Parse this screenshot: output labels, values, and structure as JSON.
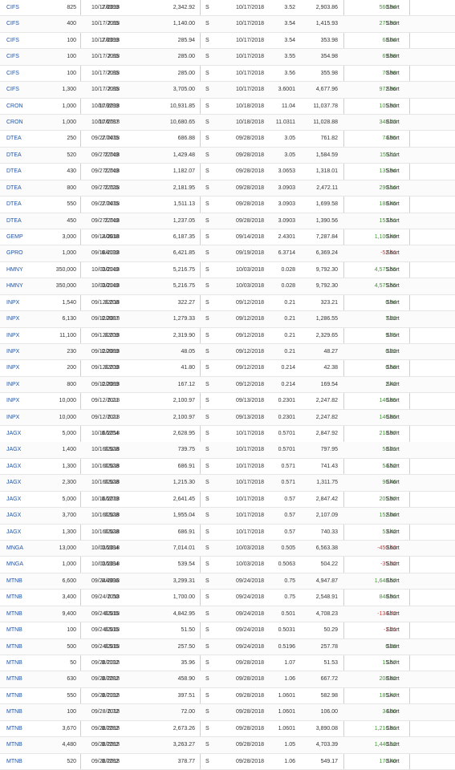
{
  "rows": [
    {
      "symbol": "CIFS",
      "qty": "825",
      "buy_date": "10/17/2018",
      "buy_price": "2.8399",
      "buy_amount": "2,342.92",
      "side": "S",
      "sell_date": "10/17/2018",
      "sell_price": "3.52",
      "sell_amount": "2,903.86",
      "pnl": "560.94",
      "pnl_sign": "pos",
      "term": "Short"
    },
    {
      "symbol": "CIFS",
      "qty": "400",
      "buy_date": "10/17/2018",
      "buy_price": "2.85",
      "buy_amount": "1,140.00",
      "side": "S",
      "sell_date": "10/17/2018",
      "sell_price": "3.54",
      "sell_amount": "1,415.93",
      "pnl": "275.93",
      "pnl_sign": "pos",
      "term": "Short"
    },
    {
      "symbol": "CIFS",
      "qty": "100",
      "buy_date": "10/17/2018",
      "buy_price": "2.8399",
      "buy_amount": "285.94",
      "side": "S",
      "sell_date": "10/17/2018",
      "sell_price": "3.54",
      "sell_amount": "353.98",
      "pnl": "68.04",
      "pnl_sign": "pos",
      "term": "Short"
    },
    {
      "symbol": "CIFS",
      "qty": "100",
      "buy_date": "10/17/2018",
      "buy_price": "2.85",
      "buy_amount": "285.00",
      "side": "S",
      "sell_date": "10/17/2018",
      "sell_price": "3.55",
      "sell_amount": "354.98",
      "pnl": "69.98",
      "pnl_sign": "pos",
      "term": "Short"
    },
    {
      "symbol": "CIFS",
      "qty": "100",
      "buy_date": "10/17/2018",
      "buy_price": "2.85",
      "buy_amount": "285.00",
      "side": "S",
      "sell_date": "10/17/2018",
      "sell_price": "3.56",
      "sell_amount": "355.98",
      "pnl": "70.98",
      "pnl_sign": "pos",
      "term": "Short"
    },
    {
      "symbol": "CIFS",
      "qty": "1,300",
      "buy_date": "10/17/2018",
      "buy_price": "2.85",
      "buy_amount": "3,705.00",
      "side": "S",
      "sell_date": "10/17/2018",
      "sell_price": "3.6001",
      "sell_amount": "4,677.96",
      "pnl": "972.96",
      "pnl_sign": "pos",
      "term": "Short"
    },
    {
      "symbol": "CRON",
      "qty": "1,000",
      "buy_date": "10/17/2018",
      "buy_price": "10.9299",
      "buy_amount": "10,931.85",
      "side": "S",
      "sell_date": "10/18/2018",
      "sell_price": "11.04",
      "sell_amount": "11,037.78",
      "pnl": "105.93",
      "pnl_sign": "pos",
      "term": "Short"
    },
    {
      "symbol": "CRON",
      "qty": "1,000",
      "buy_date": "10/17/2018",
      "buy_price": "10.6787",
      "buy_amount": "10,680.65",
      "side": "S",
      "sell_date": "10/18/2018",
      "sell_price": "11.0311",
      "sell_amount": "11,028.88",
      "pnl": "348.23",
      "pnl_sign": "pos",
      "term": "Short"
    },
    {
      "symbol": "DTEA",
      "qty": "250",
      "buy_date": "09/27/2018",
      "buy_price": "2.7475",
      "buy_amount": "686.88",
      "side": "S",
      "sell_date": "09/28/2018",
      "sell_price": "3.05",
      "sell_amount": "761.82",
      "pnl": "74.95",
      "pnl_sign": "pos",
      "term": "Short"
    },
    {
      "symbol": "DTEA",
      "qty": "520",
      "buy_date": "09/27/2018",
      "buy_price": "2.749",
      "buy_amount": "1,429.48",
      "side": "S",
      "sell_date": "09/28/2018",
      "sell_price": "3.05",
      "sell_amount": "1,584.59",
      "pnl": "155.11",
      "pnl_sign": "pos",
      "term": "Short"
    },
    {
      "symbol": "DTEA",
      "qty": "430",
      "buy_date": "09/27/2018",
      "buy_price": "2.749",
      "buy_amount": "1,182.07",
      "side": "S",
      "sell_date": "09/28/2018",
      "sell_price": "3.0653",
      "sell_amount": "1,318.01",
      "pnl": "135.94",
      "pnl_sign": "pos",
      "term": "Short"
    },
    {
      "symbol": "DTEA",
      "qty": "800",
      "buy_date": "09/27/2018",
      "buy_price": "2.725",
      "buy_amount": "2,181.95",
      "side": "S",
      "sell_date": "09/28/2018",
      "sell_price": "3.0903",
      "sell_amount": "2,472.11",
      "pnl": "290.16",
      "pnl_sign": "pos",
      "term": "Short"
    },
    {
      "symbol": "DTEA",
      "qty": "550",
      "buy_date": "09/27/2018",
      "buy_price": "2.7475",
      "buy_amount": "1,511.13",
      "side": "S",
      "sell_date": "09/28/2018",
      "sell_price": "3.0903",
      "sell_amount": "1,699.58",
      "pnl": "188.45",
      "pnl_sign": "pos",
      "term": "Short"
    },
    {
      "symbol": "DTEA",
      "qty": "450",
      "buy_date": "09/27/2018",
      "buy_price": "2.749",
      "buy_amount": "1,237.05",
      "side": "S",
      "sell_date": "09/28/2018",
      "sell_price": "3.0903",
      "sell_amount": "1,390.56",
      "pnl": "153.51",
      "pnl_sign": "pos",
      "term": "Short"
    },
    {
      "symbol": "GEMP",
      "qty": "3,000",
      "buy_date": "09/14/2018",
      "buy_price": "2.0618",
      "buy_amount": "6,187.35",
      "side": "S",
      "sell_date": "09/14/2018",
      "sell_price": "2.4301",
      "sell_amount": "7,287.84",
      "pnl": "1,100.49",
      "pnl_sign": "pos",
      "term": "Short"
    },
    {
      "symbol": "GPRO",
      "qty": "1,000",
      "buy_date": "09/18/2018",
      "buy_price": "6.4199",
      "buy_amount": "6,421.85",
      "side": "S",
      "sell_date": "09/19/2018",
      "sell_price": "6.3714",
      "sell_amount": "6,369.24",
      "pnl": "-52.61",
      "pnl_sign": "neg",
      "term": "Short"
    },
    {
      "symbol": "HMNY",
      "qty": "350,000",
      "buy_date": "10/03/2018",
      "buy_price": "0.0149",
      "buy_amount": "5,216.75",
      "side": "S",
      "sell_date": "10/03/2018",
      "sell_price": "0.028",
      "sell_amount": "9,792.30",
      "pnl": "4,575.55",
      "pnl_sign": "pos",
      "term": "Short"
    },
    {
      "symbol": "HMNY",
      "qty": "350,000",
      "buy_date": "10/03/2018",
      "buy_price": "0.0149",
      "buy_amount": "5,216.75",
      "side": "S",
      "sell_date": "10/03/2018",
      "sell_price": "0.028",
      "sell_amount": "9,792.30",
      "pnl": "4,575.55",
      "pnl_sign": "pos",
      "term": "Short"
    },
    {
      "symbol": "INPX",
      "qty": "1,540",
      "buy_date": "09/12/2018",
      "buy_price": "0.208",
      "buy_amount": "322.27",
      "side": "S",
      "sell_date": "09/12/2018",
      "sell_price": "0.21",
      "sell_amount": "323.21",
      "pnl": "0.94",
      "pnl_sign": "pos",
      "term": "Short"
    },
    {
      "symbol": "INPX",
      "qty": "6,130",
      "buy_date": "09/12/2018",
      "buy_price": "0.2087",
      "buy_amount": "1,279.33",
      "side": "S",
      "sell_date": "09/12/2018",
      "sell_price": "0.21",
      "sell_amount": "1,286.55",
      "pnl": "7.22",
      "pnl_sign": "pos",
      "term": "Short"
    },
    {
      "symbol": "INPX",
      "qty": "11,100",
      "buy_date": "09/12/2018",
      "buy_price": "0.209",
      "buy_amount": "2,319.90",
      "side": "S",
      "sell_date": "09/12/2018",
      "sell_price": "0.21",
      "sell_amount": "2,329.65",
      "pnl": "9.75",
      "pnl_sign": "pos",
      "term": "Short"
    },
    {
      "symbol": "INPX",
      "qty": "230",
      "buy_date": "09/12/2018",
      "buy_price": "0.2089",
      "buy_amount": "48.05",
      "side": "S",
      "sell_date": "09/12/2018",
      "sell_price": "0.21",
      "sell_amount": "48.27",
      "pnl": "0.22",
      "pnl_sign": "pos",
      "term": "Short"
    },
    {
      "symbol": "INPX",
      "qty": "200",
      "buy_date": "09/12/2018",
      "buy_price": "0.209",
      "buy_amount": "41.80",
      "side": "S",
      "sell_date": "09/12/2018",
      "sell_price": "0.214",
      "sell_amount": "42.38",
      "pnl": "0.58",
      "pnl_sign": "pos",
      "term": "Short"
    },
    {
      "symbol": "INPX",
      "qty": "800",
      "buy_date": "09/12/2018",
      "buy_price": "0.2089",
      "buy_amount": "167.12",
      "side": "S",
      "sell_date": "09/12/2018",
      "sell_price": "0.214",
      "sell_amount": "169.54",
      "pnl": "2.42",
      "pnl_sign": "pos",
      "term": "Short"
    },
    {
      "symbol": "INPX",
      "qty": "10,000",
      "buy_date": "09/12/2018",
      "buy_price": "0.21",
      "buy_amount": "2,100.97",
      "side": "S",
      "sell_date": "09/13/2018",
      "sell_price": "0.2301",
      "sell_amount": "2,247.82",
      "pnl": "146.85",
      "pnl_sign": "pos",
      "term": "Short"
    },
    {
      "symbol": "INPX",
      "qty": "10,000",
      "buy_date": "09/12/2018",
      "buy_price": "0.21",
      "buy_amount": "2,100.97",
      "side": "S",
      "sell_date": "09/13/2018",
      "sell_price": "0.2301",
      "sell_amount": "2,247.82",
      "pnl": "146.85",
      "pnl_sign": "pos",
      "term": "Short"
    },
    {
      "symbol": "JAGX",
      "qty": "5,000",
      "buy_date": "10/16/2018",
      "buy_price": "0.5254",
      "buy_amount": "2,628.95",
      "side": "S",
      "sell_date": "10/17/2018",
      "sell_price": "0.5701",
      "sell_amount": "2,847.92",
      "pnl": "218.97",
      "pnl_sign": "pos",
      "term": "Short"
    },
    {
      "symbol": "JAGX",
      "qty": "1,400",
      "buy_date": "10/16/2018",
      "buy_price": "0.528",
      "buy_amount": "739.75",
      "side": "S",
      "sell_date": "10/17/2018",
      "sell_price": "0.5701",
      "sell_amount": "797.95",
      "pnl": "58.21",
      "pnl_sign": "pos",
      "term": "Short"
    },
    {
      "symbol": "JAGX",
      "qty": "1,300",
      "buy_date": "10/16/2018",
      "buy_price": "0.528",
      "buy_amount": "686.91",
      "side": "S",
      "sell_date": "10/17/2018",
      "sell_price": "0.571",
      "sell_amount": "741.43",
      "pnl": "54.52",
      "pnl_sign": "pos",
      "term": "Short"
    },
    {
      "symbol": "JAGX",
      "qty": "2,300",
      "buy_date": "10/16/2018",
      "buy_price": "0.528",
      "buy_amount": "1,215.30",
      "side": "S",
      "sell_date": "10/17/2018",
      "sell_price": "0.571",
      "sell_amount": "1,311.75",
      "pnl": "96.46",
      "pnl_sign": "pos",
      "term": "Short"
    },
    {
      "symbol": "JAGX",
      "qty": "5,000",
      "buy_date": "10/16/2018",
      "buy_price": "0.5279",
      "buy_amount": "2,641.45",
      "side": "S",
      "sell_date": "10/17/2018",
      "sell_price": "0.57",
      "sell_amount": "2,847.42",
      "pnl": "205.97",
      "pnl_sign": "pos",
      "term": "Short"
    },
    {
      "symbol": "JAGX",
      "qty": "3,700",
      "buy_date": "10/16/2018",
      "buy_price": "0.528",
      "buy_amount": "1,955.04",
      "side": "S",
      "sell_date": "10/17/2018",
      "sell_price": "0.57",
      "sell_amount": "2,107.09",
      "pnl": "152.04",
      "pnl_sign": "pos",
      "term": "Short"
    },
    {
      "symbol": "JAGX",
      "qty": "1,300",
      "buy_date": "10/16/2018",
      "buy_price": "0.528",
      "buy_amount": "686.91",
      "side": "S",
      "sell_date": "10/17/2018",
      "sell_price": "0.57",
      "sell_amount": "740.33",
      "pnl": "53.42",
      "pnl_sign": "pos",
      "term": "Short"
    },
    {
      "symbol": "MNGA",
      "qty": "13,000",
      "buy_date": "10/03/2018",
      "buy_price": "0.5394",
      "buy_amount": "7,014.01",
      "side": "S",
      "sell_date": "10/03/2018",
      "sell_price": "0.505",
      "sell_amount": "6,563.38",
      "pnl": "-450.63",
      "pnl_sign": "neg",
      "term": "Short"
    },
    {
      "symbol": "MNGA",
      "qty": "1,000",
      "buy_date": "10/03/2018",
      "buy_price": "0.5394",
      "buy_amount": "539.54",
      "side": "S",
      "sell_date": "10/03/2018",
      "sell_price": "0.5063",
      "sell_amount": "504.22",
      "pnl": "-35.32",
      "pnl_sign": "neg",
      "term": "Short"
    },
    {
      "symbol": "MTNB",
      "qty": "6,600",
      "buy_date": "09/24/2018",
      "buy_price": "0.4996",
      "buy_amount": "3,299.31",
      "side": "S",
      "sell_date": "09/24/2018",
      "sell_price": "0.75",
      "sell_amount": "4,947.87",
      "pnl": "1,648.57",
      "pnl_sign": "pos",
      "term": "Short"
    },
    {
      "symbol": "MTNB",
      "qty": "3,400",
      "buy_date": "09/24/2018",
      "buy_price": "0.50",
      "buy_amount": "1,700.00",
      "side": "S",
      "sell_date": "09/24/2018",
      "sell_price": "0.75",
      "sell_amount": "2,548.91",
      "pnl": "848.91",
      "pnl_sign": "pos",
      "term": "Short"
    },
    {
      "symbol": "MTNB",
      "qty": "9,400",
      "buy_date": "09/24/2018",
      "buy_price": "0.515",
      "buy_amount": "4,842.95",
      "side": "S",
      "sell_date": "09/24/2018",
      "sell_price": "0.501",
      "sell_amount": "4,708.23",
      "pnl": "-134.72",
      "pnl_sign": "neg",
      "term": "Short"
    },
    {
      "symbol": "MTNB",
      "qty": "100",
      "buy_date": "09/24/2018",
      "buy_price": "0.515",
      "buy_amount": "51.50",
      "side": "S",
      "sell_date": "09/24/2018",
      "sell_price": "0.5031",
      "sell_amount": "50.29",
      "pnl": "-1.21",
      "pnl_sign": "neg",
      "term": "Short"
    },
    {
      "symbol": "MTNB",
      "qty": "500",
      "buy_date": "09/24/2018",
      "buy_price": "0.515",
      "buy_amount": "257.50",
      "side": "S",
      "sell_date": "09/24/2018",
      "sell_price": "0.5196",
      "sell_amount": "257.78",
      "pnl": "0.28",
      "pnl_sign": "pos",
      "term": "Short"
    },
    {
      "symbol": "MTNB",
      "qty": "50",
      "buy_date": "09/28/2018",
      "buy_price": "0.7192",
      "buy_amount": "35.96",
      "side": "S",
      "sell_date": "09/28/2018",
      "sell_price": "1.07",
      "sell_amount": "51.53",
      "pnl": "15.57",
      "pnl_sign": "pos",
      "term": "Short"
    },
    {
      "symbol": "MTNB",
      "qty": "630",
      "buy_date": "09/28/2018",
      "buy_price": "0.7282",
      "buy_amount": "458.90",
      "side": "S",
      "sell_date": "09/28/2018",
      "sell_price": "1.06",
      "sell_amount": "667.72",
      "pnl": "208.82",
      "pnl_sign": "pos",
      "term": "Short"
    },
    {
      "symbol": "MTNB",
      "qty": "550",
      "buy_date": "09/28/2018",
      "buy_price": "0.7192",
      "buy_amount": "397.51",
      "side": "S",
      "sell_date": "09/28/2018",
      "sell_price": "1.0601",
      "sell_amount": "582.98",
      "pnl": "185.47",
      "pnl_sign": "pos",
      "term": "Short"
    },
    {
      "symbol": "MTNB",
      "qty": "100",
      "buy_date": "09/28/2018",
      "buy_price": "0.72",
      "buy_amount": "72.00",
      "side": "S",
      "sell_date": "09/28/2018",
      "sell_price": "1.0601",
      "sell_amount": "106.00",
      "pnl": "34.00",
      "pnl_sign": "pos",
      "term": "Short"
    },
    {
      "symbol": "MTNB",
      "qty": "3,670",
      "buy_date": "09/28/2018",
      "buy_price": "0.7282",
      "buy_amount": "2,673.26",
      "side": "S",
      "sell_date": "09/28/2018",
      "sell_price": "1.0601",
      "sell_amount": "3,890.08",
      "pnl": "1,216.81",
      "pnl_sign": "pos",
      "term": "Short"
    },
    {
      "symbol": "MTNB",
      "qty": "4,480",
      "buy_date": "09/28/2018",
      "buy_price": "0.7282",
      "buy_amount": "3,263.27",
      "side": "S",
      "sell_date": "09/28/2018",
      "sell_price": "1.05",
      "sell_amount": "4,703.39",
      "pnl": "1,440.12",
      "pnl_sign": "pos",
      "term": "Short"
    },
    {
      "symbol": "MTNB",
      "qty": "520",
      "buy_date": "09/28/2018",
      "buy_price": "0.7282",
      "buy_amount": "378.77",
      "side": "S",
      "sell_date": "09/28/2018",
      "sell_price": "1.06",
      "sell_amount": "549.17",
      "pnl": "170.40",
      "pnl_sign": "pos",
      "term": "Short"
    }
  ],
  "colors": {
    "link": "#1f55a8",
    "gain": "#3c9a2e",
    "loss": "#d23a3a"
  }
}
